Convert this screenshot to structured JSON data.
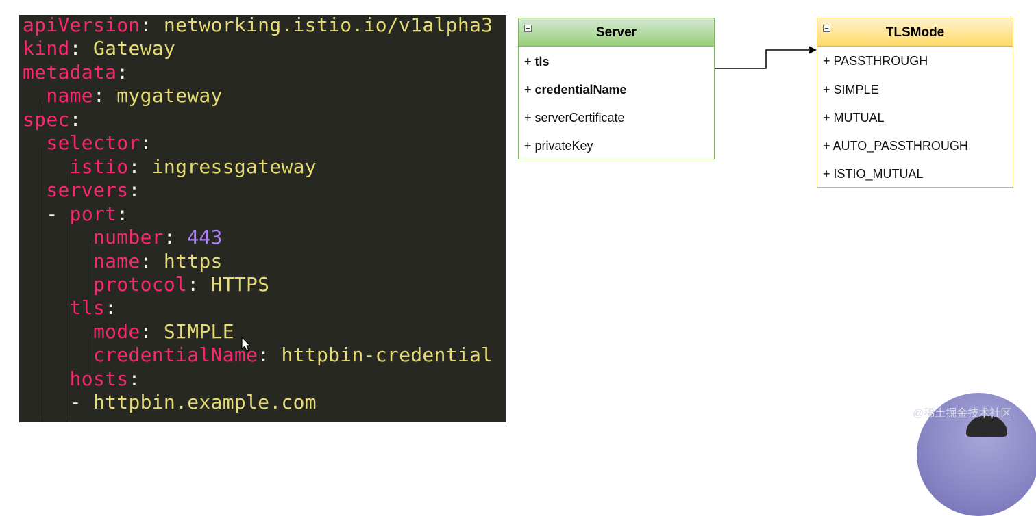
{
  "code": {
    "lines": [
      {
        "key": "apiVersion",
        "sep": ": ",
        "val": "networking.istio.io/v1alpha3"
      },
      {
        "key": "kind",
        "sep": ": ",
        "val": "Gateway"
      },
      {
        "key": "metadata",
        "sep": ":",
        "val": ""
      },
      {
        "indent": "  ",
        "key": "name",
        "sep": ": ",
        "val": "mygateway"
      },
      {
        "key": "spec",
        "sep": ":",
        "val": ""
      },
      {
        "indent": "  ",
        "key": "selector",
        "sep": ":",
        "val": ""
      },
      {
        "indent": "    ",
        "key": "istio",
        "sep": ": ",
        "val": "ingressgateway"
      },
      {
        "indent": "  ",
        "key": "servers",
        "sep": ":",
        "val": ""
      },
      {
        "indent": "  ",
        "dash": "- ",
        "key": "port",
        "sep": ":",
        "val": ""
      },
      {
        "indent": "      ",
        "key": "number",
        "sep": ": ",
        "num": "443"
      },
      {
        "indent": "      ",
        "key": "name",
        "sep": ": ",
        "val": "https"
      },
      {
        "indent": "      ",
        "key": "protocol",
        "sep": ": ",
        "val": "HTTPS"
      },
      {
        "indent": "    ",
        "key": "tls",
        "sep": ":",
        "val": ""
      },
      {
        "indent": "      ",
        "key": "mode",
        "sep": ": ",
        "val": "SIMPLE"
      },
      {
        "indent": "      ",
        "key": "credentialName",
        "sep": ": ",
        "val": "httpbin-credential"
      },
      {
        "indent": "    ",
        "key": "hosts",
        "sep": ":",
        "val": ""
      },
      {
        "indent": "    ",
        "dash": "- ",
        "key": "",
        "sep": "",
        "val": "httpbin.example.com"
      }
    ]
  },
  "server_box": {
    "title": "Server",
    "rows": [
      "+ tls",
      "+ credentialName",
      "+ serverCertificate",
      "+ privateKey"
    ]
  },
  "tls_box": {
    "title": "TLSMode",
    "rows": [
      "+ PASSTHROUGH",
      "+ SIMPLE",
      "+ MUTUAL",
      "+ AUTO_PASSTHROUGH",
      "+ ISTIO_MUTUAL"
    ]
  },
  "watermark": "@稀土掘金技术社区",
  "colors": {
    "code_bg": "#272822",
    "key": "#f92672",
    "value": "#e6db74",
    "number": "#ae81ff",
    "server_border": "#82b366",
    "tls_border": "#d6b656"
  }
}
